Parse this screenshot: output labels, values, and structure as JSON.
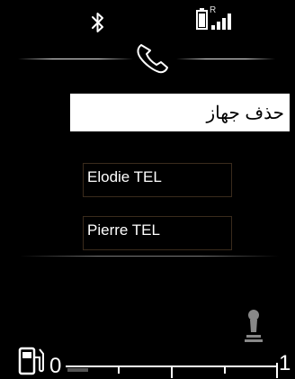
{
  "status_bar": {
    "bluetooth_icon": "bluetooth-icon",
    "battery_icon": "battery-icon",
    "roaming_label": "R",
    "signal_icon": "signal-strength-icon"
  },
  "header": {
    "icon": "phone-handset-icon"
  },
  "menu": {
    "selected_item": "حذف جهاز",
    "devices": [
      "Elodie TEL",
      "Pierre TEL"
    ]
  },
  "footer": {
    "seat_icon": "seat-adjust-icon",
    "fuel_icon": "fuel-pump-icon",
    "fuel_gauge": {
      "min_label": "0",
      "max_label": "1",
      "level": 0.1
    }
  },
  "colors": {
    "background": "#000000",
    "text": "#ffffff",
    "highlight": "#ffffff"
  }
}
